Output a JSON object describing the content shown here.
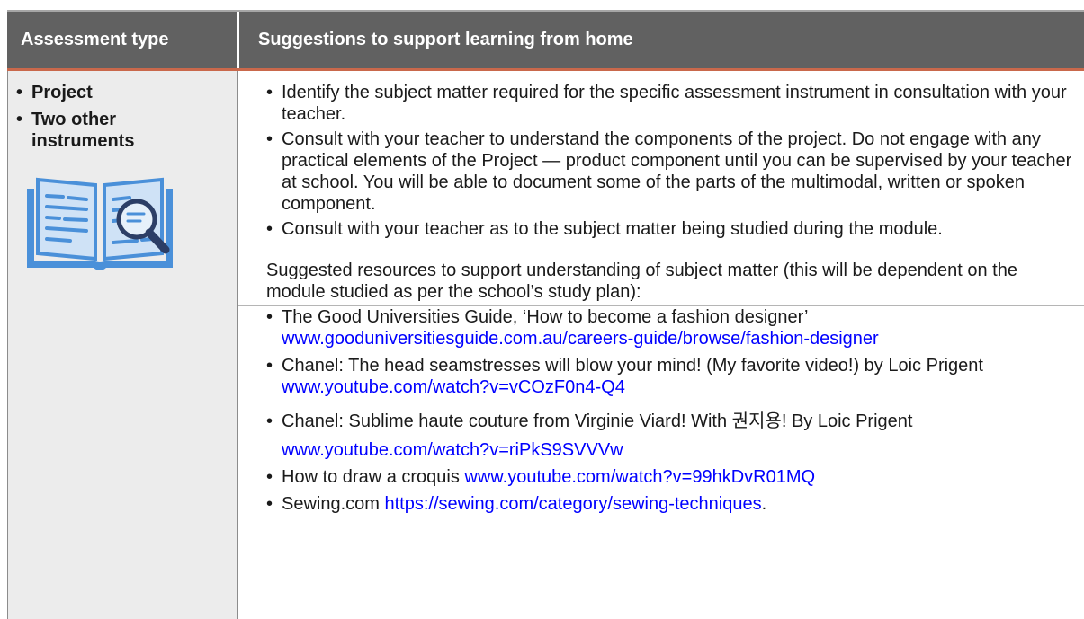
{
  "header": {
    "col1_title": "Assessment type",
    "col2_title": "Suggestions to support learning from home"
  },
  "assessment_types": [
    "Project",
    "Two other instruments"
  ],
  "icon": "book-with-magnifier-icon",
  "suggestions": [
    "Identify the subject matter required for the specific assessment instrument in consultation with your teacher.",
    "Consult with your teacher to understand the components of the project. Do not engage with any practical elements of the Project — product component until you can be supervised by your teacher at school. You will be able to document some of the parts of the multimodal, written or spoken component.",
    "Consult with your teacher as to the subject matter being studied during the module."
  ],
  "resources_intro": "Suggested resources to support understanding of subject matter (this will be dependent on the module studied as per the school’s study plan):",
  "resources": [
    {
      "text": "The Good Universities Guide, ‘How to become a fashion designer’ ",
      "link": "www.gooduniversitiesguide.com.au/careers-guide/browse/fashion-designer"
    },
    {
      "text": "Chanel: The head seamstresses will blow your mind! (My favorite video!) by Loic Prigent ",
      "link": "www.youtube.com/watch?v=vCOzF0n4-Q4"
    },
    {
      "text": "Chanel: Sublime haute couture from Virginie Viard! With 권지용! By Loic Prigent ",
      "link": "www.youtube.com/watch?v=riPkS9SVVVw"
    },
    {
      "text": "How to draw a croquis ",
      "link": "www.youtube.com/watch?v=99hkDvR01MQ"
    },
    {
      "text": "Sewing.com ",
      "link": "https://sewing.com/category/sewing-techniques",
      "tail": "."
    }
  ],
  "colors": {
    "header_bg": "#616161",
    "accent": "#c9684b",
    "link": "#0000ff",
    "icon_blue": "#4a90d9"
  }
}
